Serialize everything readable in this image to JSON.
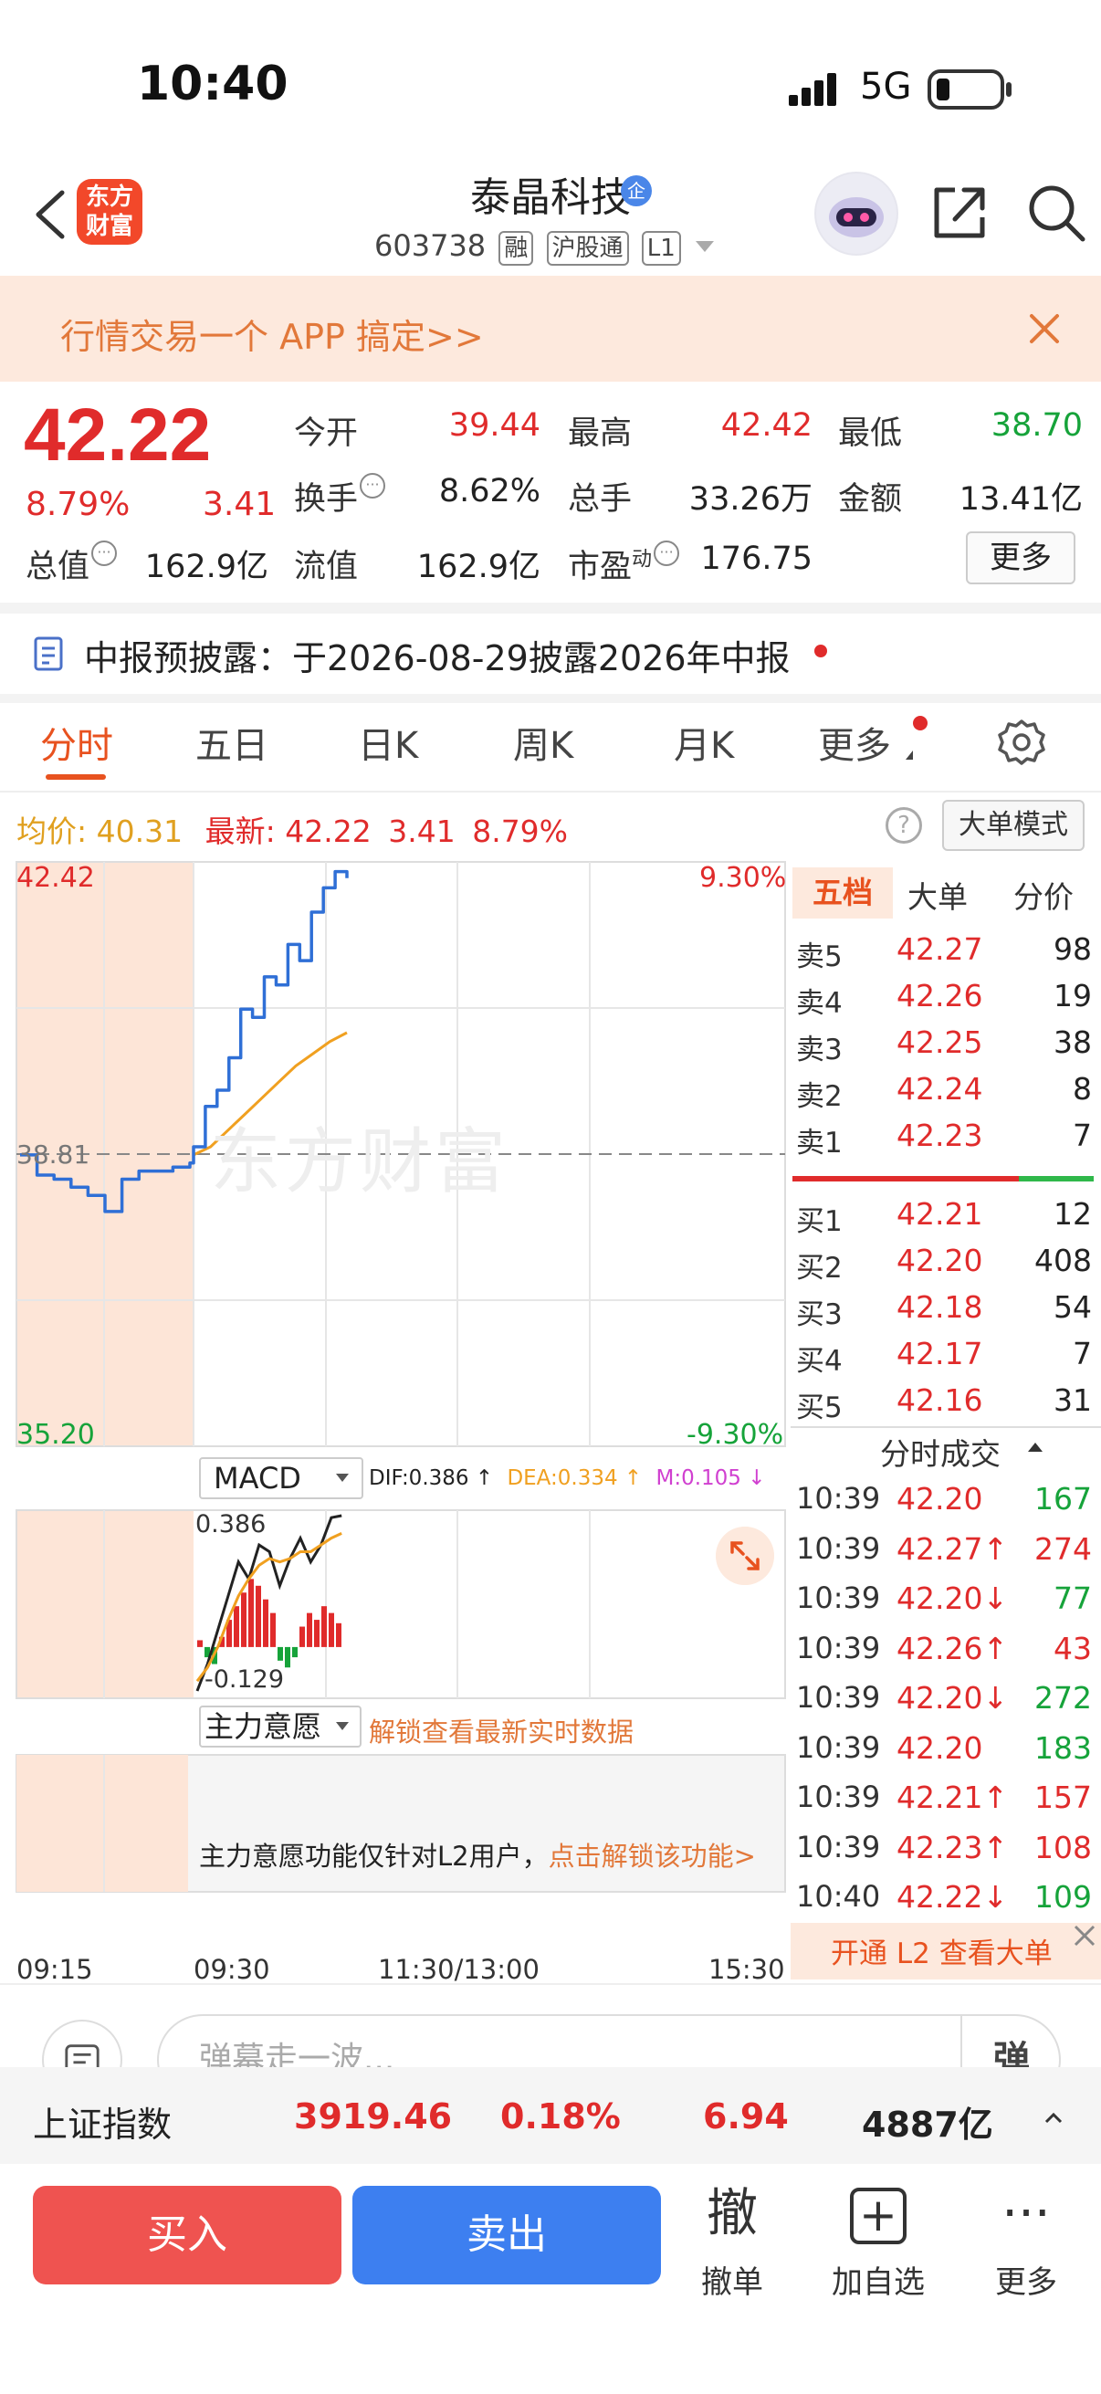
{
  "status": {
    "time": "10:40",
    "network": "5G"
  },
  "header": {
    "logo_line1": "东方",
    "logo_line2": "财富",
    "stock_name": "泰晶科技",
    "verified_badge": "企",
    "code": "603738",
    "tags": [
      "融",
      "沪股通",
      "L1"
    ]
  },
  "banner": {
    "text": "行情交易一个 APP 搞定>>"
  },
  "quote": {
    "price": "42.22",
    "change_pct": "8.79%",
    "change_amt": "3.41",
    "fields": {
      "open_label": "今开",
      "open": "39.44",
      "high_label": "最高",
      "high": "42.42",
      "low_label": "最低",
      "low": "38.70",
      "turnover_label": "换手",
      "turnover": "8.62%",
      "volume_label": "总手",
      "volume": "33.26万",
      "amount_label": "金额",
      "amount": "13.41亿",
      "mktcap_label": "总值",
      "mktcap": "162.9亿",
      "float_label": "流值",
      "float": "162.9亿",
      "pe_label": "市盈",
      "pe_sup": "动",
      "pe": "176.75"
    },
    "more_label": "更多"
  },
  "report": {
    "text": "中报预披露：于2026-08-29披露2026年中报"
  },
  "tabs": [
    {
      "label": "分时"
    },
    {
      "label": "五日"
    },
    {
      "label": "日K"
    },
    {
      "label": "周K"
    },
    {
      "label": "月K"
    },
    {
      "label": "更多"
    }
  ],
  "avgline": {
    "avg_label": "均价:",
    "avg": "40.31",
    "latest_label": "最新:",
    "latest": "42.22",
    "chg": "3.41",
    "pct": "8.79%",
    "help": "?",
    "big_order_mode": "大单模式"
  },
  "chart": {
    "max": "42.42",
    "max_pct": "9.30%",
    "min": "35.20",
    "min_pct": "-9.30%",
    "ref": "38.81",
    "watermark": "东方财富",
    "macd_label": "MACD",
    "macd_dif": "DIF:0.386 ↑",
    "macd_dea": "DEA:0.334 ↑",
    "macd_m": "M:0.105 ↓",
    "macd_top": "0.386",
    "macd_bottom": "-0.129",
    "flow_label": "主力意愿",
    "flow_unlock": "解锁查看最新实时数据",
    "flow_msg": "主力意愿功能仅针对L2用户，",
    "flow_msg_link": "点击解锁该功能>",
    "times": [
      "09:15",
      "09:30",
      "11:30/13:00",
      "15:30"
    ]
  },
  "chart_data": {
    "type": "line",
    "x_sessions": [
      "09:15",
      "09:30",
      "11:30/13:00",
      "15:30"
    ],
    "ylim": [
      35.2,
      42.42
    ],
    "reference": 38.81,
    "series": [
      {
        "values": [
          38.8,
          38.55,
          38.5,
          38.4,
          38.3,
          38.1,
          38.5,
          38.6,
          38.6,
          38.65,
          38.7,
          38.9,
          39.4,
          39.6,
          40.0,
          40.6,
          40.5,
          41.0,
          40.9,
          41.4,
          41.2,
          41.8,
          42.1,
          42.3,
          42.22
        ]
      },
      {
        "values": [
          38.8,
          38.9,
          39.1,
          39.3,
          39.5,
          39.7,
          39.9,
          40.05,
          40.2,
          40.31
        ]
      }
    ],
    "macd": {
      "dif": 0.386,
      "dea": 0.334,
      "m": 0.105,
      "max": 0.386,
      "min": -0.129
    }
  },
  "orderbook": {
    "tabs": [
      "五档",
      "大单",
      "分价"
    ],
    "asks": [
      {
        "label": "卖5",
        "price": "42.27",
        "vol": "98"
      },
      {
        "label": "卖4",
        "price": "42.26",
        "vol": "19"
      },
      {
        "label": "卖3",
        "price": "42.25",
        "vol": "38"
      },
      {
        "label": "卖2",
        "price": "42.24",
        "vol": "8"
      },
      {
        "label": "卖1",
        "price": "42.23",
        "vol": "7"
      }
    ],
    "bids": [
      {
        "label": "买1",
        "price": "42.21",
        "vol": "12"
      },
      {
        "label": "买2",
        "price": "42.20",
        "vol": "408"
      },
      {
        "label": "买3",
        "price": "42.18",
        "vol": "54"
      },
      {
        "label": "买4",
        "price": "42.17",
        "vol": "7"
      },
      {
        "label": "买5",
        "price": "42.16",
        "vol": "31"
      }
    ],
    "ticks_title": "分时成交",
    "ticks": [
      {
        "time": "10:39",
        "price": "42.20",
        "vol": "167",
        "pc": "red",
        "vc": "green"
      },
      {
        "time": "10:39",
        "price": "42.27↑",
        "vol": "274",
        "pc": "red",
        "vc": "red"
      },
      {
        "time": "10:39",
        "price": "42.20↓",
        "vol": "77",
        "pc": "red",
        "vc": "green"
      },
      {
        "time": "10:39",
        "price": "42.26↑",
        "vol": "43",
        "pc": "red",
        "vc": "red"
      },
      {
        "time": "10:39",
        "price": "42.20↓",
        "vol": "272",
        "pc": "red",
        "vc": "green"
      },
      {
        "time": "10:39",
        "price": "42.20",
        "vol": "183",
        "pc": "red",
        "vc": "green"
      },
      {
        "time": "10:39",
        "price": "42.21↑",
        "vol": "157",
        "pc": "red",
        "vc": "red"
      },
      {
        "time": "10:39",
        "price": "42.23↑",
        "vol": "108",
        "pc": "red",
        "vc": "red"
      },
      {
        "time": "10:40",
        "price": "42.22↓",
        "vol": "109",
        "pc": "red",
        "vc": "green"
      }
    ],
    "l2_banner": "开通 L2 查看大单"
  },
  "comment": {
    "placeholder": "弹幕走一波...",
    "send": "弹"
  },
  "index": {
    "name": "上证指数",
    "value": "3919.46",
    "pct": "0.18%",
    "chg": "6.94",
    "amount": "4887亿"
  },
  "actions": {
    "buy": "买入",
    "sell": "卖出",
    "cancel_icon": "撤",
    "cancel": "撤单",
    "watch_icon": "+",
    "watch": "加自选",
    "more_icon": "···",
    "more": "更多"
  },
  "colors": {
    "up": "#e02b2b",
    "down": "#16a33a",
    "accent": "#e8521f",
    "price_line": "#2f6fd6",
    "avg_line": "#f0a020"
  }
}
